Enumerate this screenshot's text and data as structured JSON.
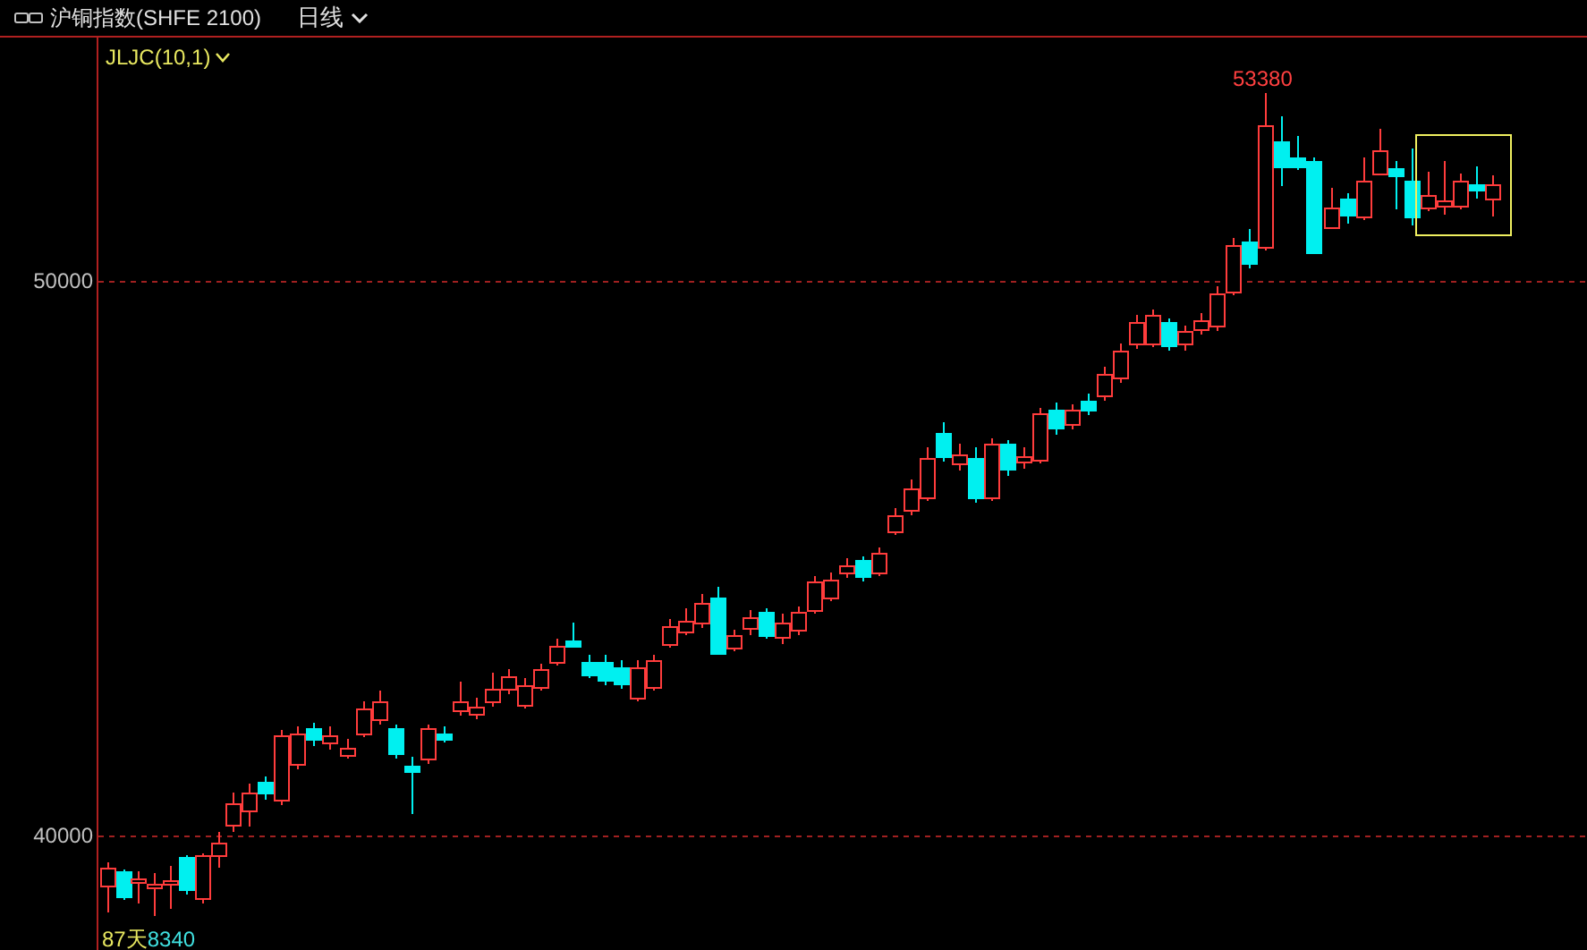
{
  "header": {
    "title": "沪铜指数(SHFE 2100)",
    "period": "日线"
  },
  "indicator": {
    "label": "JLJC(10,1)"
  },
  "y_axis": {
    "ticks": [
      {
        "label": "50000"
      },
      {
        "label": "40000"
      }
    ]
  },
  "high_label": "53380",
  "footer_labels": [
    {
      "kind": "days",
      "text": "87天"
    },
    {
      "kind": "low",
      "text": "8340"
    }
  ]
}
